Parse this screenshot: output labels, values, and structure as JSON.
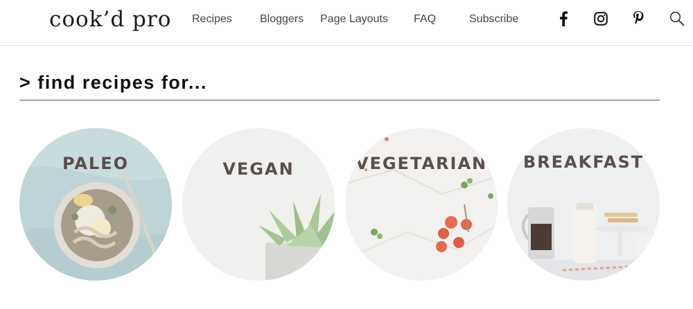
{
  "site": {
    "logo": "cook’d pro"
  },
  "nav": {
    "items": [
      {
        "label": "Recipes"
      },
      {
        "label": "Bloggers"
      },
      {
        "label": "Page Layouts"
      },
      {
        "label": "FAQ"
      },
      {
        "label": "Subscribe"
      }
    ]
  },
  "social": {
    "icons": [
      "facebook-icon",
      "instagram-icon",
      "pinterest-icon",
      "search-icon"
    ]
  },
  "main": {
    "heading": ">  find recipes for...",
    "categories": [
      {
        "label": "PALEO"
      },
      {
        "label": "VEGAN"
      },
      {
        "label": "VEGETARIAN"
      },
      {
        "label": "BREAKFAST"
      }
    ]
  },
  "colors": {
    "label_text": "#5a4f4c",
    "header_border": "#dcdcdc",
    "rule": "#555555"
  }
}
